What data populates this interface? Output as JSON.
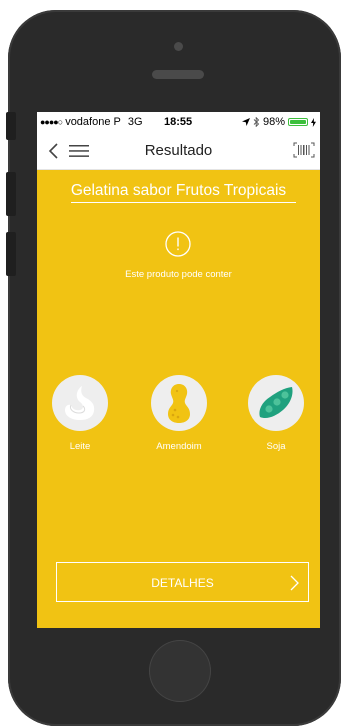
{
  "status_bar": {
    "carrier": "vodafone P",
    "network": "3G",
    "time": "18:55",
    "battery_percent": "98%",
    "battery_level": 0.98,
    "icons": [
      "signal-dots-icon",
      "location-arrow-icon",
      "bluetooth-icon",
      "battery-icon",
      "charging-icon"
    ]
  },
  "nav": {
    "title": "Resultado",
    "icons": [
      "back-chevron-icon",
      "menu-icon",
      "barcode-icon"
    ]
  },
  "product": {
    "name": "Gelatina sabor Frutos Tropicais"
  },
  "warning": {
    "icon": "exclamation-circle-icon",
    "text": "Este produto pode conter"
  },
  "allergens": [
    {
      "label": "Leite",
      "icon": "milk-icon"
    },
    {
      "label": "Amendoim",
      "icon": "peanut-icon"
    },
    {
      "label": "Soja",
      "icon": "soy-icon"
    }
  ],
  "details_button": {
    "label": "DETALHES",
    "icon": "chevron-right-icon"
  },
  "colors": {
    "accent": "#f1c313",
    "text_on_accent": "#ffffff",
    "icon_bg": "#eeeeee",
    "peanut": "#f1c313",
    "soy": "#1fa17e"
  }
}
